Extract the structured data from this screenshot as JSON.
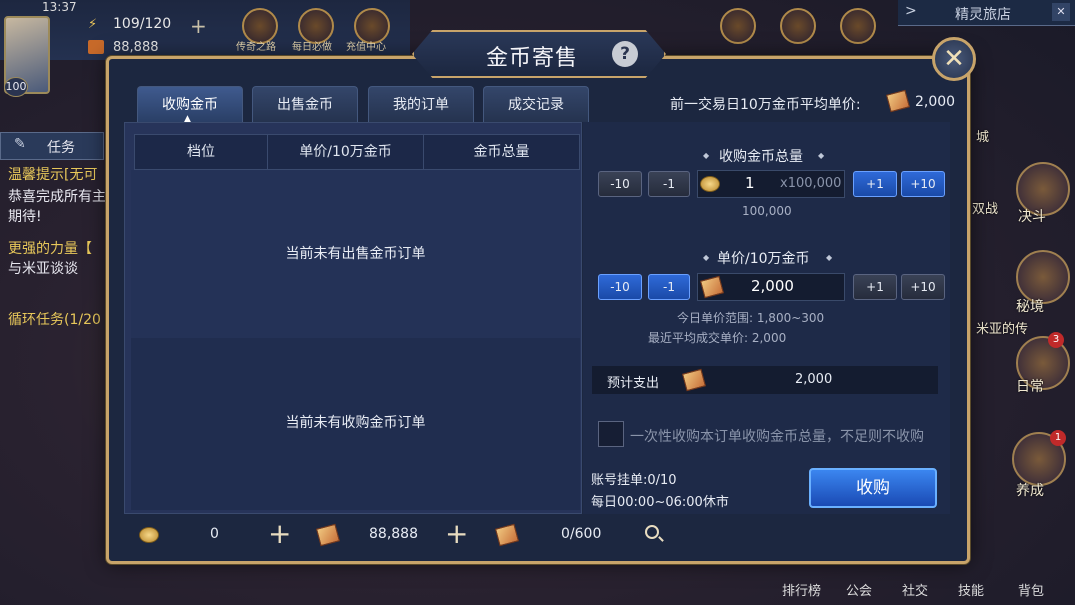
{
  "hud": {
    "time": "13:37",
    "stamina": "109/120",
    "gems": "88,888",
    "avatar_level": "100",
    "menu": [
      "传奇之路",
      "每日必做",
      "充值中心"
    ],
    "top_right_title": "精灵旅店",
    "task_label": "任务",
    "quest_lines": [
      {
        "text": "温馨提示[无可",
        "color": "#e8c85a"
      },
      {
        "text": "恭喜完成所有主",
        "color": "#e8e8f0"
      },
      {
        "text": "期待!",
        "color": "#e8e8f0"
      },
      {
        "text": "更强的力量【",
        "color": "#e8c85a"
      },
      {
        "text": "与米亚谈谈",
        "color": "#e8e8f0"
      },
      {
        "text": "循环任务(1/20",
        "color": "#e8c85a"
      }
    ],
    "right_icons": [
      {
        "label": "决斗",
        "badge": ""
      },
      {
        "label": "秘境",
        "badge": ""
      },
      {
        "label": "日常",
        "badge": "3"
      },
      {
        "label": "养成",
        "badge": "1"
      }
    ],
    "side_texts": [
      "双战",
      "城",
      "米亚的传"
    ],
    "bottom_labels": [
      "排行榜",
      "公会",
      "社交",
      "技能",
      "背包"
    ]
  },
  "modal": {
    "title": "金币寄售",
    "help_icon": "question-icon",
    "close_icon": "close-icon",
    "tabs": [
      {
        "label": "收购金币",
        "active": true
      },
      {
        "label": "出售金币",
        "active": false
      },
      {
        "label": "我的订单",
        "active": false
      },
      {
        "label": "成交记录",
        "active": false
      }
    ],
    "avg_price_label": "前一交易日10万金币平均单价:",
    "avg_price_value": "2,000",
    "table": {
      "columns": [
        "档位",
        "单价/10万金币",
        "金币总量"
      ],
      "empty_sell": "当前未有出售金币订单",
      "empty_buy": "当前未有收购金币订单"
    },
    "footer": {
      "coins": "0",
      "gems": "88,888",
      "tickets": "0/600"
    },
    "form": {
      "qty_title": "收购金币总量",
      "qty_buttons": [
        "-10",
        "-1",
        "+1",
        "+10"
      ],
      "qty_value": "1",
      "qty_unit": "x100,000",
      "qty_total": "100,000",
      "price_title": "单价/10万金币",
      "price_buttons": [
        "-10",
        "-1",
        "+1",
        "+10"
      ],
      "price_value": "2,000",
      "price_range": "今日单价范围: 1,800~300",
      "recent_avg": "最近平均成交单价: 2,000",
      "expense_label": "预计支出",
      "expense_value": "2,000",
      "checkbox_label": "一次性收购本订单收购金币总量，不足则不收购",
      "account_orders": "账号挂单:0/10",
      "market_hours": "每日00:00~06:00休市",
      "buy_button": "收购"
    }
  }
}
